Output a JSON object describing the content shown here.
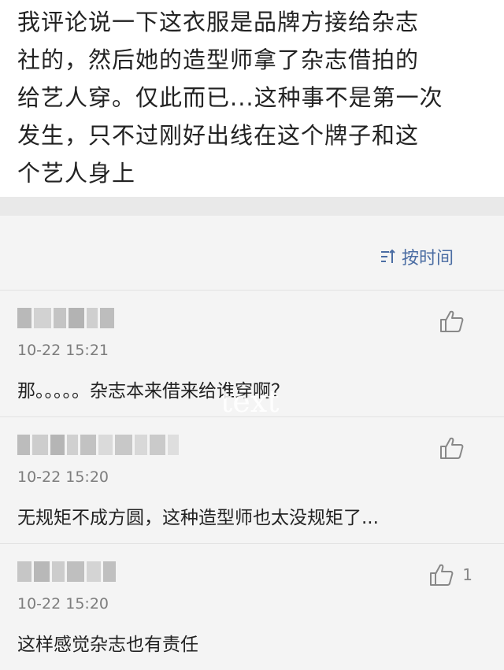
{
  "main_comment": {
    "lines": [
      "我评论说一下这衣服是品牌方接给杂志",
      "社的，然后她的造型师拿了杂志借拍的",
      "给艺人穿。仅此而已...这种事不是第一次",
      "发生，只不过刚好出线在这个牌子和这",
      "个艺人身上"
    ]
  },
  "sort": {
    "label": "按时间",
    "icon": "sort-icon",
    "color": "#4b6da3"
  },
  "comments": [
    {
      "timestamp": "10-22 15:21",
      "text": "那。。。。。杂志本来借来给谁穿啊？",
      "like_count": ""
    },
    {
      "timestamp": "10-22 15:20",
      "text": "无规矩不成方圆，这种造型师也太没规矩了...",
      "like_count": ""
    },
    {
      "timestamp": "10-22 15:20",
      "text": "这样感觉杂志也有责任",
      "like_count": "1"
    }
  ],
  "watermark": {
    "text": "text"
  }
}
